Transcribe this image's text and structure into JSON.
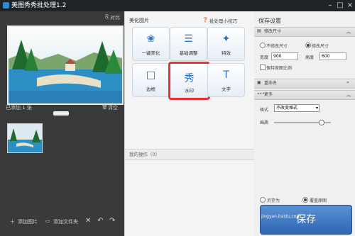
{
  "window": {
    "title": "美图秀秀批处理1.2"
  },
  "left": {
    "compare": "对比",
    "added_label": "已添加 1 张",
    "clear": "清空",
    "add_image": "添加图片",
    "add_folder": "添加文件夹"
  },
  "center": {
    "header": "美化图片",
    "help": "批处理小技巧",
    "tiles": [
      {
        "label": "一键美化",
        "icon": "❀"
      },
      {
        "label": "基础调整",
        "icon": "☰"
      },
      {
        "label": "特效",
        "icon": "✦"
      },
      {
        "label": "边框",
        "icon": "□"
      },
      {
        "label": "水印",
        "icon": "秀"
      },
      {
        "label": "文字",
        "icon": "T"
      }
    ],
    "ops": "我的操作（0）"
  },
  "right": {
    "title": "保存设置",
    "section_size": "修改尺寸",
    "no_change": "不修改尺寸",
    "change": "修改尺寸",
    "width_label": "宽度",
    "width_value": "900",
    "height_label": "高度",
    "height_value": "600",
    "keep_ratio": "保持原图比例",
    "section_rename": "重命名",
    "section_more": "更多",
    "format_label": "格式",
    "format_value": "不改变格式",
    "quality_label": "画质",
    "save_as": "另存为",
    "overwrite": "覆盖原图",
    "save_button": "保存"
  },
  "watermark": "jingyan.baidu.com"
}
